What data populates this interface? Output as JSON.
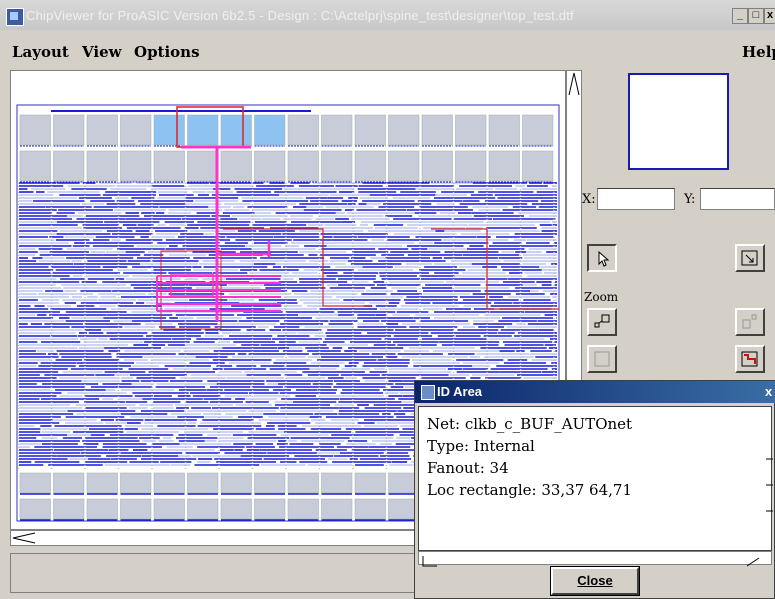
{
  "window": {
    "title": "ChipViewer for ProASIC Version 6b2.5 - Design : C:\\Actelprj\\spine_test\\designer\\top_test.dtf",
    "buttons": {
      "minimize": "_",
      "maximize": "□",
      "close": "x"
    }
  },
  "menu": {
    "layout": "Layout",
    "view": "View",
    "options": "Options",
    "help": "Help"
  },
  "coords": {
    "x_label": "X:",
    "y_label": "Y:",
    "x_value": "",
    "y_value": ""
  },
  "tools": {
    "zoom_label": "Zoom"
  },
  "id_area": {
    "title": "ID Area",
    "close_x": "x",
    "net": "Net: clkb_c_BUF_AUTOnet",
    "type": "Type: Internal",
    "fanout": "Fanout: 34",
    "loc_rectangle": "Loc rectangle: 33,37 64,71",
    "close_button": "Close"
  },
  "colors": {
    "route_blue": "#1a1ad8",
    "highlight_magenta": "#ff33cc",
    "region_red": "#e02020",
    "ram_blue": "#8ec2f0",
    "block_gray": "#c8ccd8"
  },
  "icons": {
    "select": "arrow-pointer-icon",
    "zoom_in": "zoom-in-icon",
    "zoom_out": "zoom-out-icon",
    "zoom_fit": "zoom-fit-icon",
    "zoom_box": "zoom-box-icon"
  }
}
